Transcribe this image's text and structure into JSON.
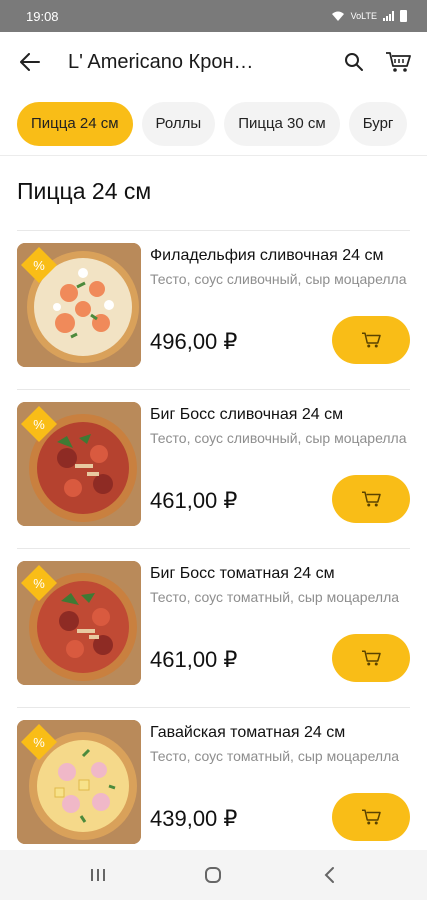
{
  "status_bar": {
    "time": "19:08",
    "network": "VoLTE"
  },
  "header": {
    "title": "L' Americano Крон…",
    "back_icon": "arrow-left-icon",
    "search_icon": "search-icon",
    "cart_icon": "cart-icon"
  },
  "tabs": [
    {
      "label": "Пицца 24 см",
      "active": true
    },
    {
      "label": "Роллы",
      "active": false
    },
    {
      "label": "Пицца 30 см",
      "active": false
    },
    {
      "label": "Бург",
      "active": false
    }
  ],
  "section": {
    "title": "Пицца 24 см"
  },
  "products": [
    {
      "name": "Филадельфия сливочная 24 см",
      "description": "Тесто, соус сливочный, сыр моцарелла",
      "price": "496,00 ₽",
      "badge_text": "%"
    },
    {
      "name": "Биг Босс сливочная 24 см",
      "description": "Тесто, соус сливочный, сыр моцарелла",
      "price": "461,00 ₽",
      "badge_text": "%"
    },
    {
      "name": "Биг Босс томатная 24 см",
      "description": "Тесто, соус томатный, сыр моцарелла",
      "price": "461,00 ₽",
      "badge_text": "%"
    },
    {
      "name": "Гавайская томатная 24 см",
      "description": "Тесто, соус томатный, сыр моцарелла",
      "price": "439,00 ₽",
      "badge_text": "%"
    }
  ],
  "colors": {
    "accent": "#f9bd17",
    "muted_text": "#8e8e8e"
  },
  "nav_bar": {
    "recents_icon": "recents-icon",
    "home_icon": "home-icon",
    "back_icon": "back-chevron-icon"
  }
}
